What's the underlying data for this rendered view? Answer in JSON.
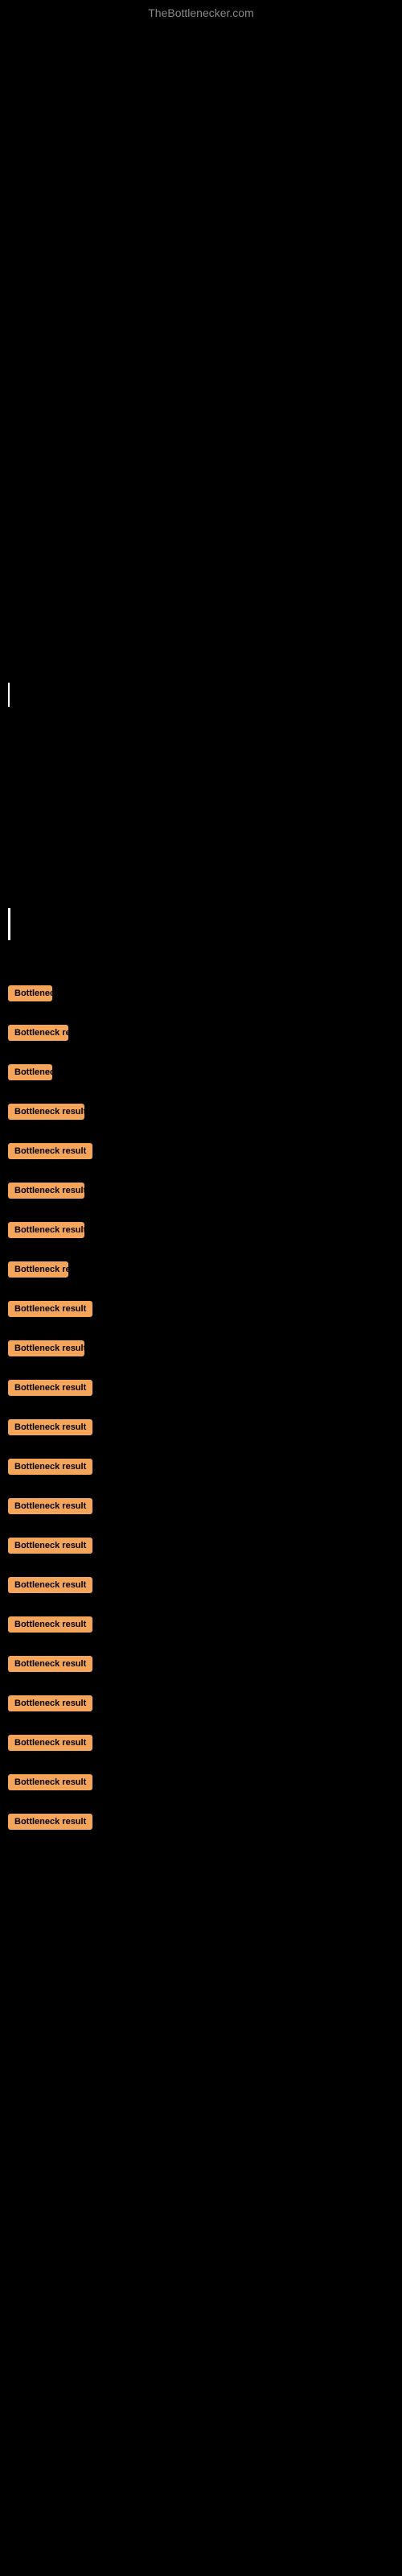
{
  "site": {
    "title": "TheBottlenecker.com"
  },
  "results": [
    {
      "id": 1,
      "label": "Bottleneck result",
      "width_class": "badge-xs"
    },
    {
      "id": 2,
      "label": "Bottleneck result",
      "width_class": "badge-sm"
    },
    {
      "id": 3,
      "label": "Bottleneck result",
      "width_class": "badge-xs"
    },
    {
      "id": 4,
      "label": "Bottleneck result",
      "width_class": "badge-md"
    },
    {
      "id": 5,
      "label": "Bottleneck result",
      "width_class": "badge-lg"
    },
    {
      "id": 6,
      "label": "Bottleneck result",
      "width_class": "badge-md"
    },
    {
      "id": 7,
      "label": "Bottleneck result",
      "width_class": "badge-md"
    },
    {
      "id": 8,
      "label": "Bottleneck result",
      "width_class": "badge-sm"
    },
    {
      "id": 9,
      "label": "Bottleneck result",
      "width_class": "badge-lg"
    },
    {
      "id": 10,
      "label": "Bottleneck result",
      "width_class": "badge-md"
    },
    {
      "id": 11,
      "label": "Bottleneck result",
      "width_class": "badge-full"
    },
    {
      "id": 12,
      "label": "Bottleneck result",
      "width_class": "badge-full"
    },
    {
      "id": 13,
      "label": "Bottleneck result",
      "width_class": "badge-full"
    },
    {
      "id": 14,
      "label": "Bottleneck result",
      "width_class": "badge-full"
    },
    {
      "id": 15,
      "label": "Bottleneck result",
      "width_class": "badge-full"
    },
    {
      "id": 16,
      "label": "Bottleneck result",
      "width_class": "badge-full"
    },
    {
      "id": 17,
      "label": "Bottleneck result",
      "width_class": "badge-full"
    },
    {
      "id": 18,
      "label": "Bottleneck result",
      "width_class": "badge-full"
    },
    {
      "id": 19,
      "label": "Bottleneck result",
      "width_class": "badge-full"
    },
    {
      "id": 20,
      "label": "Bottleneck result",
      "width_class": "badge-full"
    },
    {
      "id": 21,
      "label": "Bottleneck result",
      "width_class": "badge-full"
    },
    {
      "id": 22,
      "label": "Bottleneck result",
      "width_class": "badge-full"
    }
  ],
  "badge_color": "#f5a55a"
}
